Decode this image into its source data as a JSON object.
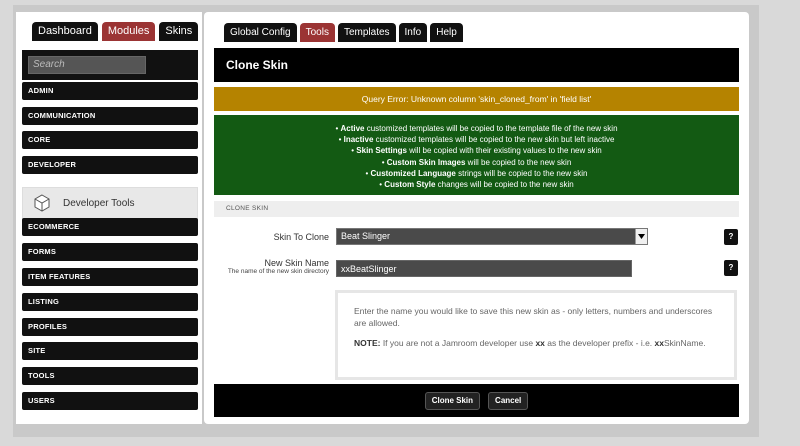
{
  "nav": {
    "top_tabs": [
      {
        "label": "Dashboard"
      },
      {
        "label": "Modules"
      },
      {
        "label": "Skins"
      }
    ]
  },
  "sidebar": {
    "search_placeholder": "Search",
    "categories": [
      "ADMIN",
      "COMMUNICATION",
      "CORE",
      "DEVELOPER"
    ],
    "active_module": "Developer Tools",
    "categories_after": [
      "ECOMMERCE",
      "FORMS",
      "ITEM FEATURES",
      "LISTING",
      "PROFILES",
      "SITE",
      "TOOLS",
      "USERS"
    ]
  },
  "main": {
    "tabs": [
      {
        "label": "Global Config"
      },
      {
        "label": "Tools"
      },
      {
        "label": "Templates"
      },
      {
        "label": "Info"
      },
      {
        "label": "Help"
      }
    ],
    "title": "Clone Skin",
    "error": "Query Error: Unknown column 'skin_cloned_from' in 'field list'",
    "info_lines": [
      {
        "bold": "Active",
        "rest": " customized templates will be copied to the template file of the new skin"
      },
      {
        "bold": "Inactive",
        "rest": " customized templates will be copied to the new skin but left inactive"
      },
      {
        "bold": "Skin Settings",
        "rest": " will be copied with their existing values to the new skin"
      },
      {
        "bold": "Custom Skin Images",
        "rest": " will be copied to the new skin"
      },
      {
        "bold": "Customized Language",
        "rest": " strings will be copied to the new skin"
      },
      {
        "bold": "Custom Style",
        "rest": " changes will be copied to the new skin"
      }
    ],
    "section_title": "CLONE SKIN",
    "skin_to_clone_label": "Skin To Clone",
    "skin_to_clone_value": "Beat Slinger",
    "new_skin_name_label": "New Skin Name",
    "new_skin_name_sub": "The name of the new skin directory",
    "new_skin_name_value": "xxBeatSlinger",
    "help_btn": "?",
    "help_p1": "Enter the name you would like to save this new skin as - only letters, numbers and underscores are allowed.",
    "help_note_bold": "NOTE:",
    "help_note_a": " If you are not a Jamroom developer use ",
    "help_note_xx": "xx",
    "help_note_b": " as the developer prefix - i.e. ",
    "help_note_xx2": "xx",
    "help_note_c": "SkinName.",
    "clone_button": "Clone Skin",
    "cancel_button": "Cancel"
  },
  "colors": {
    "active_tab": "#9b3434",
    "error_bar": "#b58300",
    "info_box": "#135a13"
  }
}
